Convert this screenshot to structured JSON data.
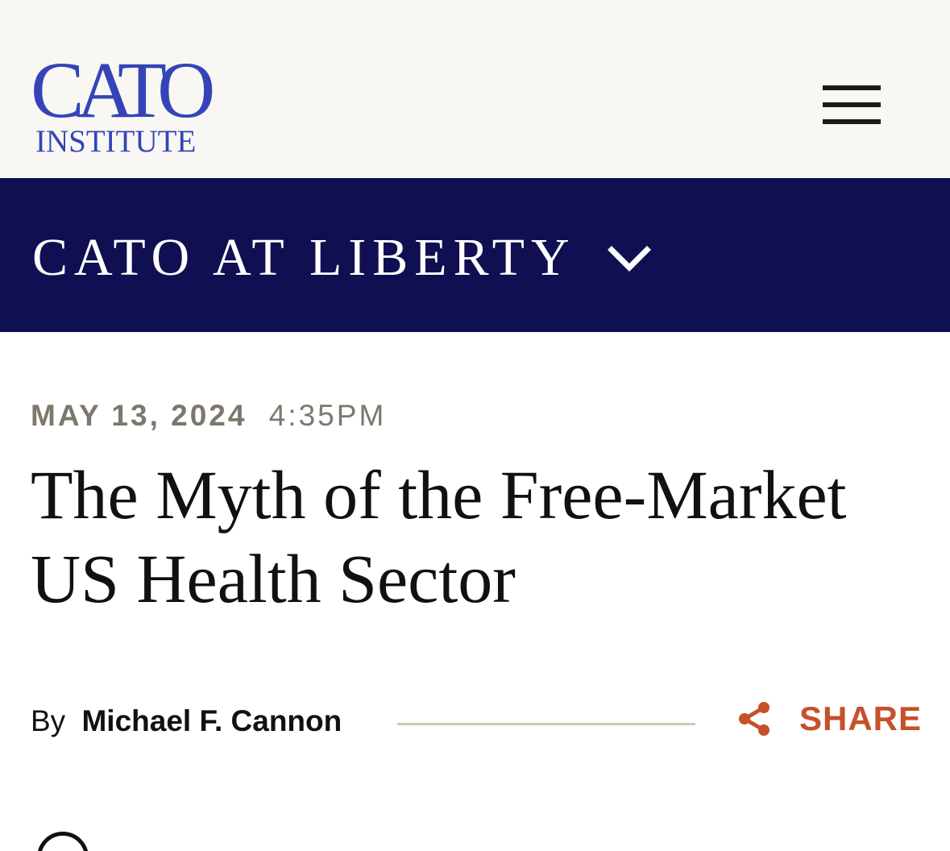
{
  "header": {
    "logo": {
      "main": "CATO",
      "sub": "INSTITUTE"
    },
    "menu_icon": "hamburger-menu-icon"
  },
  "section": {
    "title": "CATO AT LIBERTY",
    "icon": "chevron-down-icon"
  },
  "article": {
    "date": "MAY 13, 2024",
    "time": "4:35PM",
    "title": "The Myth of the Free-Market US Health Sector",
    "byline_prefix": "By",
    "author": "Michael F. Cannon",
    "share_label": "SHARE",
    "share_icon": "share-icon"
  },
  "colors": {
    "brand_blue": "#3444b8",
    "section_bar": "#0f0f52",
    "header_bg": "#f8f7f4",
    "meta_gray": "#7d776d",
    "share_accent": "#c5512b"
  }
}
